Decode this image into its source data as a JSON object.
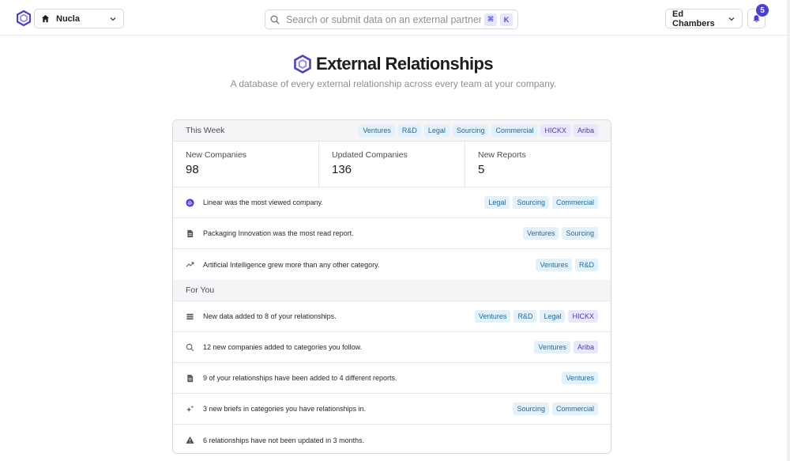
{
  "topbar": {
    "workspace_label": "Nucla",
    "search_placeholder": "Search or submit data on an external partner",
    "shortcut_keys": [
      "⌘",
      "K"
    ],
    "user_label": "Ed Chambers",
    "notification_count": "5"
  },
  "header": {
    "title": "External Relationships",
    "subtitle": "A database of every external relationship across every team at your company."
  },
  "this_week": {
    "label": "This Week",
    "tags": [
      {
        "label": "Ventures",
        "tone": "blue"
      },
      {
        "label": "R&D",
        "tone": "blue"
      },
      {
        "label": "Legal",
        "tone": "blue"
      },
      {
        "label": "Sourcing",
        "tone": "blue"
      },
      {
        "label": "Commercial",
        "tone": "blue"
      },
      {
        "label": "HICKX",
        "tone": "purple"
      },
      {
        "label": "Ariba",
        "tone": "purple"
      }
    ],
    "stats": [
      {
        "label": "New Companies",
        "value": "98"
      },
      {
        "label": "Updated Companies",
        "value": "136"
      },
      {
        "label": "New Reports",
        "value": "5"
      }
    ],
    "rows": [
      {
        "icon": "linear-logo-icon",
        "text": "Linear was the most viewed company.",
        "tags": [
          {
            "label": "Legal",
            "tone": "blue"
          },
          {
            "label": "Sourcing",
            "tone": "blue"
          },
          {
            "label": "Commercial",
            "tone": "blue"
          }
        ]
      },
      {
        "icon": "document-icon",
        "text": "Packaging Innovation was the most read report.",
        "tags": [
          {
            "label": "Ventures",
            "tone": "blue"
          },
          {
            "label": "Sourcing",
            "tone": "blue"
          }
        ]
      },
      {
        "icon": "trending-up-icon",
        "text": "Artificial Intelligence grew more than any other category.",
        "tags": [
          {
            "label": "Ventures",
            "tone": "blue"
          },
          {
            "label": "R&D",
            "tone": "blue"
          }
        ]
      }
    ]
  },
  "for_you": {
    "label": "For You",
    "rows": [
      {
        "icon": "database-icon",
        "text": "New data added to 8 of your relationships.",
        "tags": [
          {
            "label": "Ventures",
            "tone": "blue"
          },
          {
            "label": "R&D",
            "tone": "blue"
          },
          {
            "label": "Legal",
            "tone": "blue"
          },
          {
            "label": "HICKX",
            "tone": "purple"
          }
        ]
      },
      {
        "icon": "search-icon",
        "text": "12 new companies added to categories you follow.",
        "tags": [
          {
            "label": "Ventures",
            "tone": "blue"
          },
          {
            "label": "Ariba",
            "tone": "purple"
          }
        ]
      },
      {
        "icon": "document-icon",
        "text": "9 of your relationships have been added to 4 different reports.",
        "tags": [
          {
            "label": "Ventures",
            "tone": "blue"
          }
        ]
      },
      {
        "icon": "sparkles-icon",
        "text": "3 new briefs in categories you have relationships in.",
        "tags": [
          {
            "label": "Sourcing",
            "tone": "blue"
          },
          {
            "label": "Commercial",
            "tone": "blue"
          }
        ]
      },
      {
        "icon": "warning-icon",
        "text": "6 relationships have not been updated in 3 months.",
        "tags": []
      }
    ]
  },
  "colors": {
    "accent": "#4b3fd9",
    "tag_blue_bg": "#e3f1fb",
    "tag_blue_text": "#1f6c9f",
    "tag_purple_bg": "#e8e7fb",
    "tag_purple_text": "#4a40b0"
  }
}
